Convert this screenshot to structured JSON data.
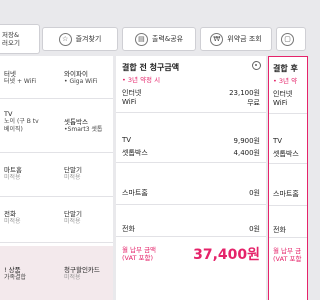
{
  "toolbar": {
    "save_line1": "저장&",
    "save_line2": "러오기",
    "favorites_label": "즐겨찾기",
    "print_share_label": "출력&공유",
    "penalty_label": "위약금 조회",
    "favorites_icon": "star-icon",
    "print_icon": "printer-icon",
    "penalty_icon": "won-coin-icon"
  },
  "products": {
    "internet": {
      "title": "터넷",
      "sub": "터넷 + WiFi"
    },
    "wifi": {
      "title": "와이파이",
      "sub": "• Giga WiFi"
    },
    "tv": {
      "title": "TV",
      "sub1": "노이 (구 B tv",
      "sub2": "베이직)"
    },
    "settop": {
      "title": "셋톱박스",
      "sub": "•Smart3 셋톱"
    },
    "smarthome": {
      "title": "마트홈",
      "sub": "미적용"
    },
    "phone_a": {
      "title": "단말기",
      "sub": "미적용"
    },
    "phone_b": {
      "title": "전화",
      "sub": "미적용"
    },
    "phone_c": {
      "title": "단말기",
      "sub": "미적용"
    },
    "combo": {
      "title": "! 상품",
      "sub": "가족결합"
    },
    "card": {
      "title": "청구할인카드",
      "sub": "미적용"
    }
  },
  "before": {
    "title": "결합 전 청구금액",
    "note": "• 3년 약정 시",
    "rows": [
      {
        "label": "인터넷",
        "value": "23,100원"
      },
      {
        "label": "WiFi",
        "value": "무료"
      },
      {
        "label": "TV",
        "value": "9,900원"
      },
      {
        "label": "셋톱박스",
        "value": "4,400원"
      },
      {
        "label": "스마트홈",
        "value": "0원"
      },
      {
        "label": "전화",
        "value": "0원"
      }
    ],
    "total_label1": "월 납부 금액",
    "total_label2": "(VAT 포함)",
    "total_value": "37,400원"
  },
  "after": {
    "title": "결합 후",
    "note": "• 3년 약",
    "rows": [
      {
        "label": "인터넷"
      },
      {
        "label": "WiFi"
      },
      {
        "label": "TV"
      },
      {
        "label": "셋톱박스"
      },
      {
        "label": "스마트홈"
      },
      {
        "label": "전화"
      }
    ],
    "total_label1": "월 납부 금",
    "total_label2": "(VAT 포함"
  },
  "colors": {
    "accent": "#e5236a",
    "background": "#e9e9ec"
  }
}
